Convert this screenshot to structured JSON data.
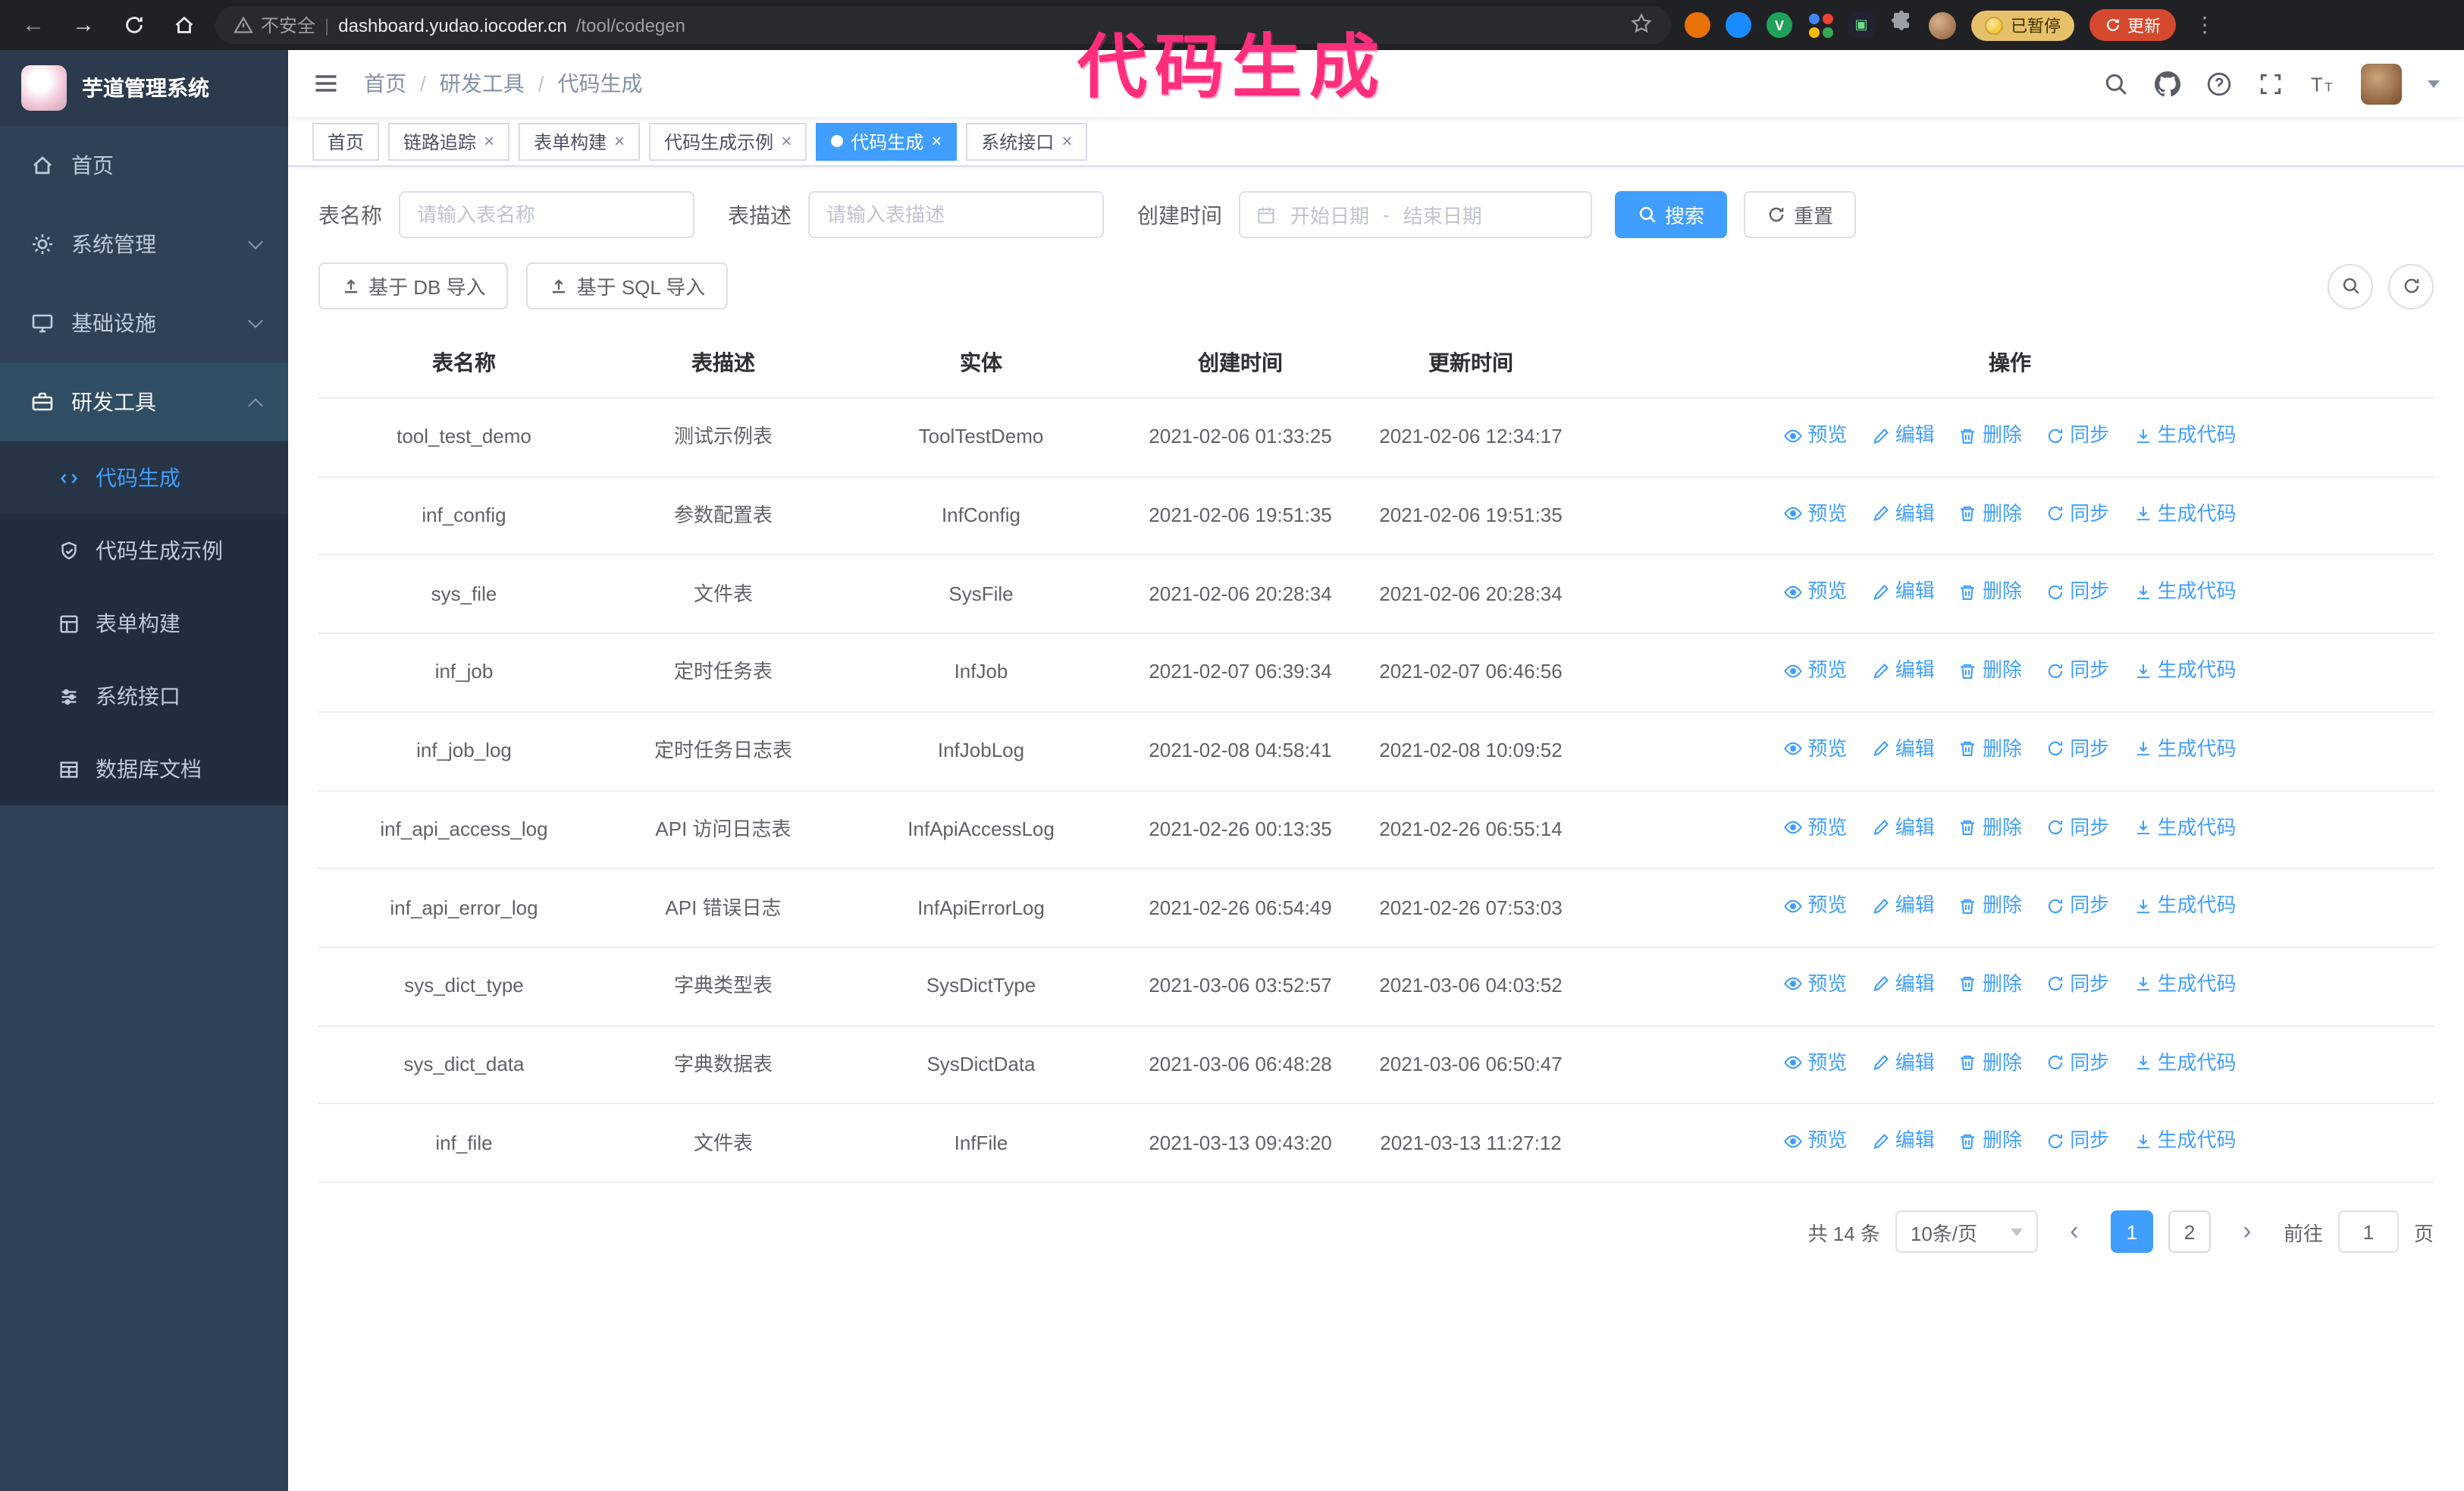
{
  "annotation": {
    "label": "代码生成"
  },
  "glyphs": {
    "back": "←",
    "forward": "→",
    "divider": "|",
    "kebab": "⋮",
    "close": "×",
    "dot": "●",
    "sep": "/",
    "prev": "‹",
    "next": "›",
    "range_sep": "-"
  },
  "browser": {
    "security_label": "不安全",
    "url_domain": "dashboard.yudao.iocoder.cn",
    "url_path": "/tool/codegen",
    "paused_badge": "已暂停",
    "update_button": "更新"
  },
  "sidebar": {
    "title": "芋道管理系统",
    "menu": [
      {
        "label": "首页"
      },
      {
        "label": "系统管理"
      },
      {
        "label": "基础设施"
      },
      {
        "label": "研发工具"
      }
    ],
    "submenu": [
      {
        "label": "代码生成"
      },
      {
        "label": "代码生成示例"
      },
      {
        "label": "表单构建"
      },
      {
        "label": "系统接口"
      },
      {
        "label": "数据库文档"
      }
    ]
  },
  "header": {
    "breadcrumb": {
      "home": "首页",
      "group": "研发工具",
      "page": "代码生成"
    }
  },
  "tabs": [
    {
      "label": "首页"
    },
    {
      "label": "链路追踪"
    },
    {
      "label": "表单构建"
    },
    {
      "label": "代码生成示例"
    },
    {
      "label": "代码生成"
    },
    {
      "label": "系统接口"
    }
  ],
  "filters": {
    "name_label": "表名称",
    "name_placeholder": "请输入表名称",
    "desc_label": "表描述",
    "desc_placeholder": "请输入表描述",
    "time_label": "创建时间",
    "start_placeholder": "开始日期",
    "end_placeholder": "结束日期",
    "search_button": "搜索",
    "reset_button": "重置"
  },
  "toolbar": {
    "import_db_button": "基于 DB 导入",
    "import_sql_button": "基于 SQL 导入"
  },
  "table": {
    "columns": [
      "表名称",
      "表描述",
      "实体",
      "创建时间",
      "更新时间",
      "操作"
    ],
    "action_labels": [
      "预览",
      "编辑",
      "删除",
      "同步",
      "生成代码"
    ],
    "rows": [
      {
        "name": "tool_test_demo",
        "desc": "测试示例表",
        "entity": "ToolTestDemo",
        "created": "2021-02-06 01:33:25",
        "updated": "2021-02-06 12:34:17"
      },
      {
        "name": "inf_config",
        "desc": "参数配置表",
        "entity": "InfConfig",
        "created": "2021-02-06 19:51:35",
        "updated": "2021-02-06 19:51:35"
      },
      {
        "name": "sys_file",
        "desc": "文件表",
        "entity": "SysFile",
        "created": "2021-02-06 20:28:34",
        "updated": "2021-02-06 20:28:34"
      },
      {
        "name": "inf_job",
        "desc": "定时任务表",
        "entity": "InfJob",
        "created": "2021-02-07 06:39:34",
        "updated": "2021-02-07 06:46:56"
      },
      {
        "name": "inf_job_log",
        "desc": "定时任务日志表",
        "entity": "InfJobLog",
        "created": "2021-02-08 04:58:41",
        "updated": "2021-02-08 10:09:52"
      },
      {
        "name": "inf_api_access_log",
        "desc": "API 访问日志表",
        "entity": "InfApiAccessLog",
        "created": "2021-02-26 00:13:35",
        "updated": "2021-02-26 06:55:14"
      },
      {
        "name": "inf_api_error_log",
        "desc": "API 错误日志",
        "entity": "InfApiErrorLog",
        "created": "2021-02-26 06:54:49",
        "updated": "2021-02-26 07:53:03"
      },
      {
        "name": "sys_dict_type",
        "desc": "字典类型表",
        "entity": "SysDictType",
        "created": "2021-03-06 03:52:57",
        "updated": "2021-03-06 04:03:52"
      },
      {
        "name": "sys_dict_data",
        "desc": "字典数据表",
        "entity": "SysDictData",
        "created": "2021-03-06 06:48:28",
        "updated": "2021-03-06 06:50:47"
      },
      {
        "name": "inf_file",
        "desc": "文件表",
        "entity": "InfFile",
        "created": "2021-03-13 09:43:20",
        "updated": "2021-03-13 11:27:12"
      }
    ]
  },
  "pagination": {
    "total_text": "共 14 条",
    "page_size": "10条/页",
    "page_1": "1",
    "page_2": "2",
    "goto_label": "前往",
    "goto_value": "1",
    "goto_unit": "页"
  },
  "colors": {
    "accent": "#409EFF",
    "annotation": "#ff2e7d",
    "sidebar_bg": "#304156",
    "submenu_bg": "#1f2d3d",
    "chrome_bg": "#202124",
    "update_pill": "#d6492f"
  }
}
